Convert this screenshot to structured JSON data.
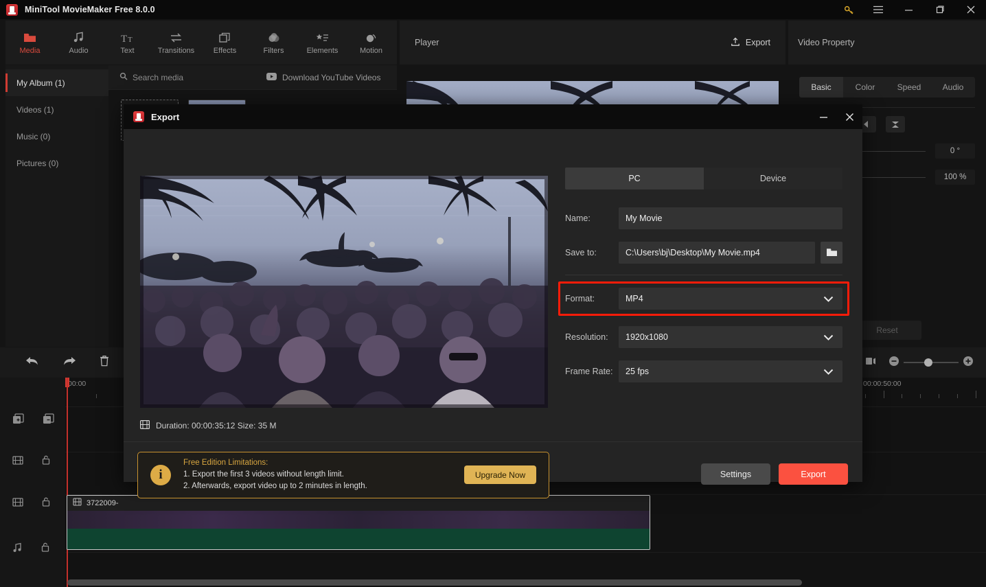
{
  "window": {
    "title": "MiniTool MovieMaker Free 8.0.0",
    "controls": {
      "key": "key-icon",
      "menu": "hamburger-icon",
      "minimize": "—",
      "maximize": "□",
      "close": "✕"
    }
  },
  "ribbon": {
    "items": [
      {
        "label": "Media",
        "icon": "folder-icon",
        "active": true
      },
      {
        "label": "Audio",
        "icon": "music-note-icon",
        "active": false
      },
      {
        "label": "Text",
        "icon": "text-icon",
        "active": false
      },
      {
        "label": "Transitions",
        "icon": "transitions-icon",
        "active": false
      },
      {
        "label": "Effects",
        "icon": "effects-icon",
        "active": false
      },
      {
        "label": "Filters",
        "icon": "filters-icon",
        "active": false
      },
      {
        "label": "Elements",
        "icon": "elements-icon",
        "active": false
      },
      {
        "label": "Motion",
        "icon": "motion-icon",
        "active": false
      }
    ]
  },
  "media": {
    "nav": [
      {
        "label": "My Album (1)",
        "active": true
      },
      {
        "label": "Videos (1)",
        "active": false
      },
      {
        "label": "Music (0)",
        "active": false
      },
      {
        "label": "Pictures (0)",
        "active": false
      }
    ],
    "search_placeholder": "Search media",
    "download_youtube": "Download YouTube Videos"
  },
  "player": {
    "title": "Player",
    "export_label": "Export"
  },
  "properties": {
    "title": "Video Property",
    "tabs": [
      {
        "label": "Basic",
        "active": true
      },
      {
        "label": "Color",
        "active": false
      },
      {
        "label": "Speed",
        "active": false
      },
      {
        "label": "Audio",
        "active": false
      }
    ],
    "rotate_value": "0 °",
    "scale_value": "100 %",
    "reset_label": "Reset"
  },
  "timeline": {
    "toolbar": {
      "undo": "undo-icon",
      "redo": "redo-icon",
      "delete": "trash-icon"
    },
    "ruler_labels": [
      "00:00",
      "00:00:50:00"
    ],
    "clip": {
      "name": "3722009-"
    },
    "zoom": {
      "out": "−",
      "in": "+"
    }
  },
  "dialog": {
    "title": "Export",
    "minimize": "—",
    "close": "✕",
    "tabs": [
      {
        "label": "PC",
        "active": true
      },
      {
        "label": "Device",
        "active": false
      }
    ],
    "fields": {
      "name": {
        "label": "Name:",
        "value": "My Movie"
      },
      "save_to": {
        "label": "Save to:",
        "value": "C:\\Users\\bj\\Desktop\\My Movie.mp4",
        "browse_icon": "folder-icon"
      },
      "format": {
        "label": "Format:",
        "value": "MP4",
        "highlighted": true
      },
      "resolution": {
        "label": "Resolution:",
        "value": "1920x1080"
      },
      "frame_rate": {
        "label": "Frame Rate:",
        "value": "25 fps"
      }
    },
    "meta": {
      "icon": "film-icon",
      "text": "Duration:  00:00:35:12  Size:  35 M"
    },
    "notice": {
      "heading": "Free Edition Limitations:",
      "line1": "1. Export the first 3 videos without length limit.",
      "line2": "2. Afterwards, export video up to 2 minutes in length.",
      "upgrade_label": "Upgrade Now"
    },
    "actions": {
      "settings": "Settings",
      "export": "Export"
    }
  },
  "colors": {
    "accent_red": "#d94a3d",
    "export_red": "#fb5140",
    "highlight_red": "#fc1c09",
    "gold": "#ddab46",
    "audio_green": "#0e4430"
  }
}
